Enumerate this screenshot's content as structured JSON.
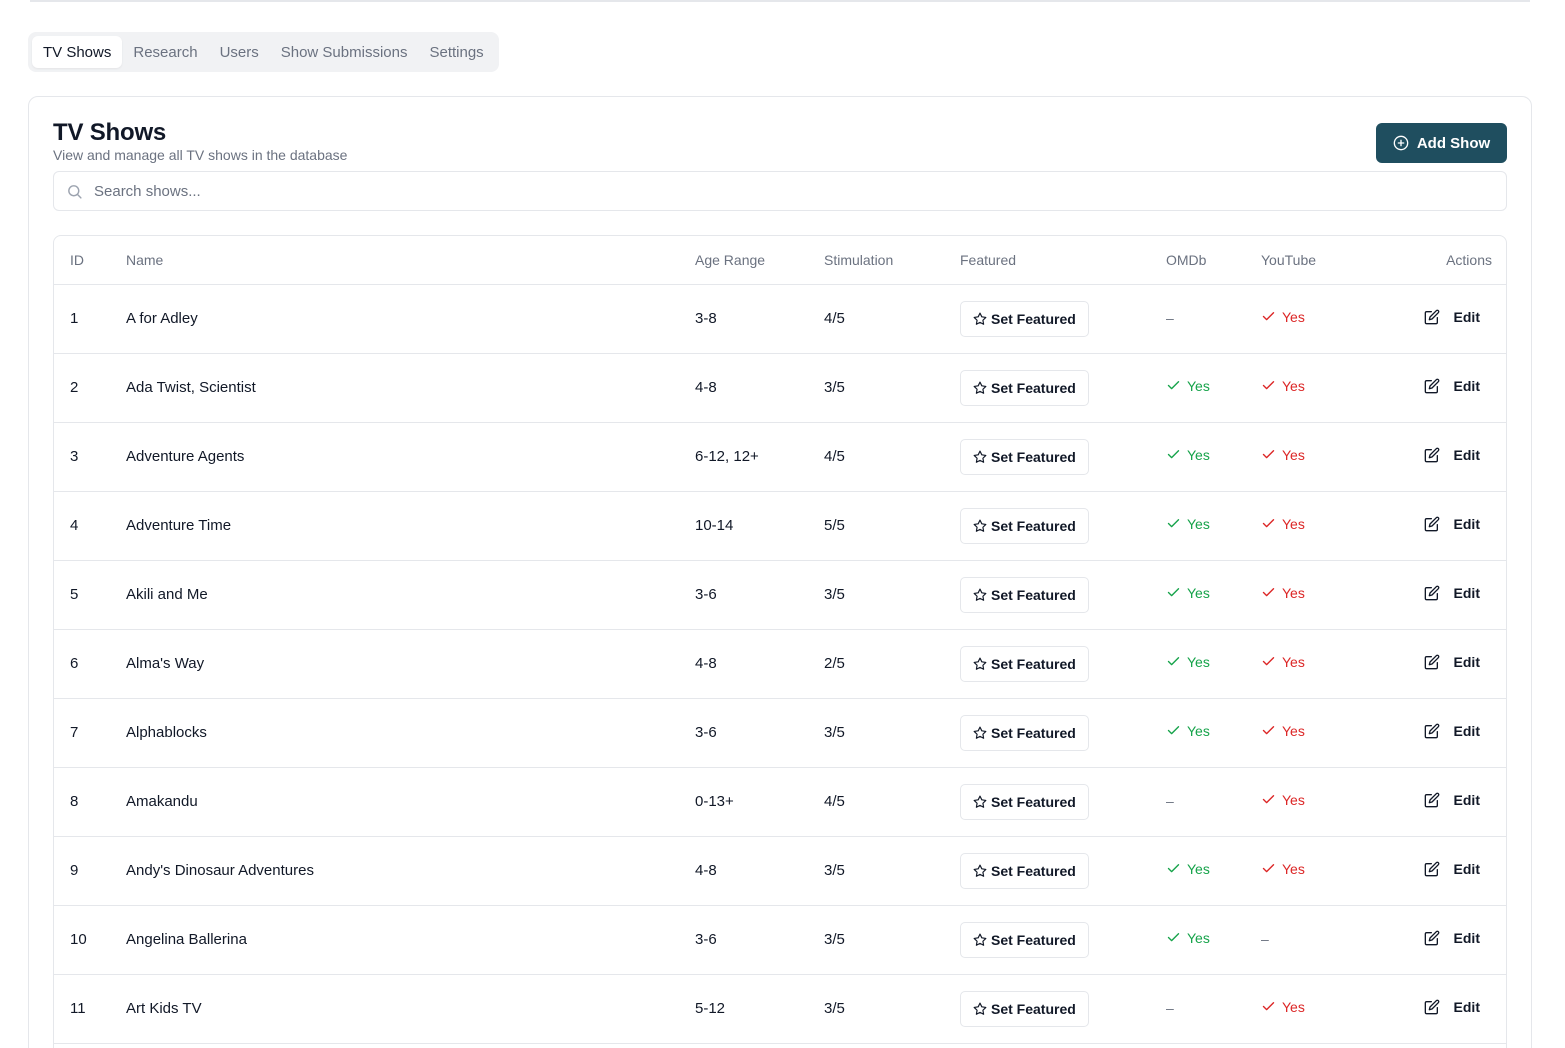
{
  "tabs": [
    {
      "label": "TV Shows",
      "active": true
    },
    {
      "label": "Research",
      "active": false
    },
    {
      "label": "Users",
      "active": false
    },
    {
      "label": "Show Submissions",
      "active": false
    },
    {
      "label": "Settings",
      "active": false
    }
  ],
  "header": {
    "title": "TV Shows",
    "subtitle": "View and manage all TV shows in the database",
    "add_button_label": "Add Show"
  },
  "search": {
    "placeholder": "Search shows...",
    "value": ""
  },
  "table": {
    "columns": [
      "ID",
      "Name",
      "Age Range",
      "Stimulation",
      "Featured",
      "OMDb",
      "YouTube",
      "Actions"
    ],
    "featured_button_label": "Set Featured",
    "edit_label": "Edit",
    "yes_label": "Yes",
    "none_label": "–",
    "rows": [
      {
        "id": "1",
        "name": "A for Adley",
        "age": "3-8",
        "stim": "4/5",
        "omdb": false,
        "youtube": true
      },
      {
        "id": "2",
        "name": "Ada Twist, Scientist",
        "age": "4-8",
        "stim": "3/5",
        "omdb": true,
        "youtube": true
      },
      {
        "id": "3",
        "name": "Adventure Agents",
        "age": "6-12, 12+",
        "stim": "4/5",
        "omdb": true,
        "youtube": true
      },
      {
        "id": "4",
        "name": "Adventure Time",
        "age": "10-14",
        "stim": "5/5",
        "omdb": true,
        "youtube": true
      },
      {
        "id": "5",
        "name": "Akili and Me",
        "age": "3-6",
        "stim": "3/5",
        "omdb": true,
        "youtube": true
      },
      {
        "id": "6",
        "name": "Alma's Way",
        "age": "4-8",
        "stim": "2/5",
        "omdb": true,
        "youtube": true
      },
      {
        "id": "7",
        "name": "Alphablocks",
        "age": "3-6",
        "stim": "3/5",
        "omdb": true,
        "youtube": true
      },
      {
        "id": "8",
        "name": "Amakandu",
        "age": "0-13+",
        "stim": "4/5",
        "omdb": false,
        "youtube": true
      },
      {
        "id": "9",
        "name": "Andy's Dinosaur Adventures",
        "age": "4-8",
        "stim": "3/5",
        "omdb": true,
        "youtube": true
      },
      {
        "id": "10",
        "name": "Angelina Ballerina",
        "age": "3-6",
        "stim": "3/5",
        "omdb": true,
        "youtube": false
      },
      {
        "id": "11",
        "name": "Art Kids TV",
        "age": "5-12",
        "stim": "3/5",
        "omdb": false,
        "youtube": true
      }
    ]
  },
  "colors": {
    "primary": "#1f4e5f",
    "omdb_yes": "#16a34a",
    "youtube_yes": "#dc2626",
    "border": "#e5e7eb",
    "muted_text": "#6b7280"
  }
}
